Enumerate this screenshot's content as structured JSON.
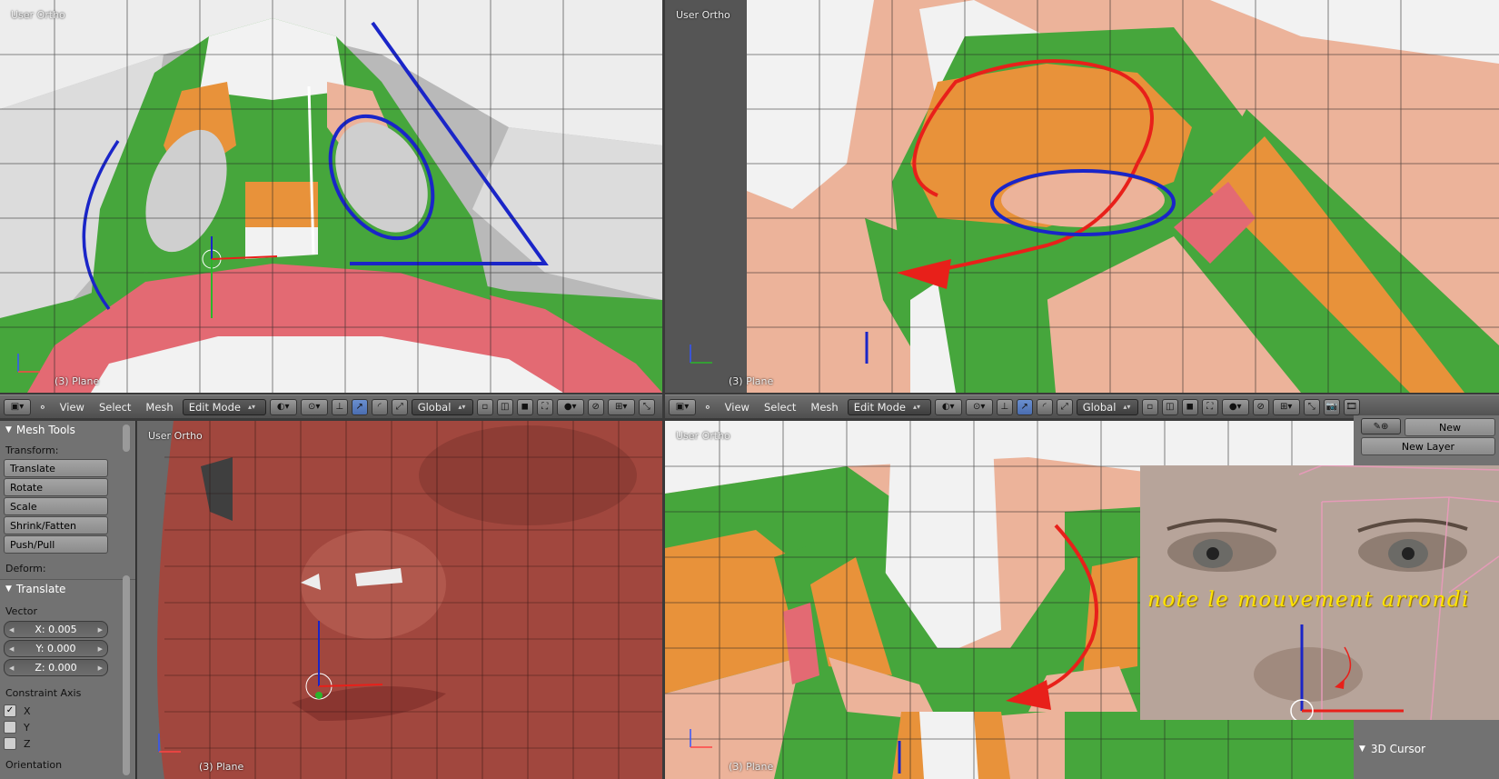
{
  "viewports": {
    "top_left": {
      "title": "User Ortho",
      "object_label": "(3) Plane"
    },
    "top_right": {
      "title": "User Ortho",
      "object_label": "(3) Plane"
    },
    "bottom_left": {
      "title": "User Ortho",
      "object_label": "(3) Plane"
    },
    "bottom_right": {
      "title": "User Ortho",
      "object_label": "(3) Plane"
    }
  },
  "header_left": {
    "menus": [
      "View",
      "Select",
      "Mesh"
    ],
    "mode": "Edit Mode",
    "orientation": "Global"
  },
  "header_right": {
    "menus": [
      "View",
      "Select",
      "Mesh"
    ],
    "mode": "Edit Mode",
    "orientation": "Global"
  },
  "toolshelf": {
    "title": "Mesh Tools",
    "transform_label": "Transform:",
    "transform_buttons": [
      "Translate",
      "Rotate",
      "Scale",
      "Shrink/Fatten",
      "Push/Pull"
    ],
    "deform_label": "Deform:",
    "operator_title": "Translate",
    "vector_label": "Vector",
    "vector": {
      "x": "X: 0.005",
      "y": "Y: 0.000",
      "z": "Z: 0.000"
    },
    "constraint_label": "Constraint Axis",
    "constraints": [
      {
        "label": "X",
        "checked": true
      },
      {
        "label": "Y",
        "checked": false
      },
      {
        "label": "Z",
        "checked": false
      }
    ],
    "orientation_label": "Orientation"
  },
  "properties": {
    "new_label": "New",
    "new_layer_label": "New Layer",
    "cursor_section": "3D Cursor"
  },
  "annotation": {
    "text": "note le mouvement arrondi"
  },
  "colors": {
    "green": "#46a63c",
    "orange": "#e8923a",
    "skin": "#ecb39a",
    "lip": "#e36a73",
    "white": "#f2f2f2",
    "clay": "#a1473e",
    "blue_stroke": "#1a25c8",
    "red_stroke": "#e8201a",
    "note_yellow": "#ffe400"
  }
}
